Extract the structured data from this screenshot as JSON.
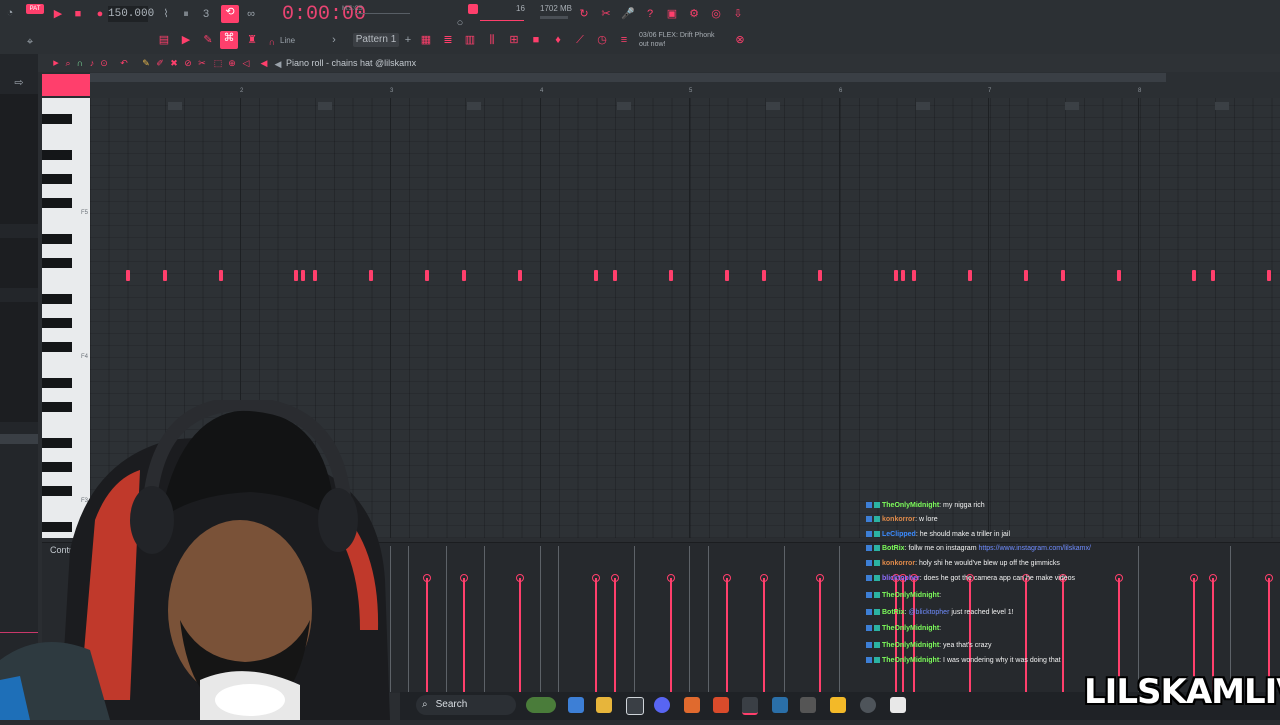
{
  "toolbar": {
    "bpm": "150.000",
    "time": "0:00:00",
    "time_unit": "M:S:CS",
    "cpu": "16",
    "memory": "1702 MB",
    "pattern": "Pattern 1",
    "snap": "Line",
    "news_line1": "03/06 FLEX: Drift Phonk",
    "news_line2": "out now!"
  },
  "piano_roll": {
    "title": "Piano roll - chains hat @lilskamx",
    "ruler": [
      "2",
      "3",
      "4",
      "5",
      "6",
      "7",
      "8"
    ],
    "key_labels": [
      "F5",
      "F4",
      "F3"
    ],
    "control_label": "Control"
  },
  "notes_x": [
    128,
    165,
    221,
    296,
    303,
    315,
    371,
    427,
    464,
    520,
    596,
    615,
    671,
    727,
    764,
    820,
    896,
    903,
    914,
    970,
    1026,
    1063,
    1119,
    1194,
    1213,
    1269
  ],
  "chat": [
    {
      "user": "TheOnlyMidnight",
      "color": "#7cfc5a",
      "text": ": my nigga rich"
    },
    {
      "user": "konkorror",
      "color": "#e08a4a",
      "text": ": w lore"
    },
    {
      "user": "LeClipped",
      "color": "#3b8bff",
      "text": ": he should make a triller in jail"
    },
    {
      "user": "BotRix",
      "color": "#7cfc5a",
      "text": ": follw me on instagram ",
      "link": "https://www.instagram.com/lilskamx/"
    },
    {
      "user": "konkorror",
      "color": "#e08a4a",
      "text": ": holy shi he would've blew up off the gimmicks"
    },
    {
      "user": "blicktopher",
      "color": "#8f6cff",
      "text": ": does he got the camera app can he make videos"
    },
    {
      "user": "TheOnlyMidnight",
      "color": "#7cfc5a",
      "text": ": "
    },
    {
      "user": "BotRix",
      "color": "#7cfc5a",
      "text": ": ",
      "mention": "@blicktopher",
      "after": " just reached level 1!"
    },
    {
      "user": "TheOnlyMidnight",
      "color": "#7cfc5a",
      "text": ": "
    },
    {
      "user": "TheOnlyMidnight",
      "color": "#7cfc5a",
      "text": ": yea that's crazy"
    },
    {
      "user": "TheOnlyMidnight",
      "color": "#7cfc5a",
      "text": ": I was wondering why it was doing that"
    }
  ],
  "taskbar": {
    "search_label": "Search"
  },
  "watermark": "LILSKAMLIVE"
}
